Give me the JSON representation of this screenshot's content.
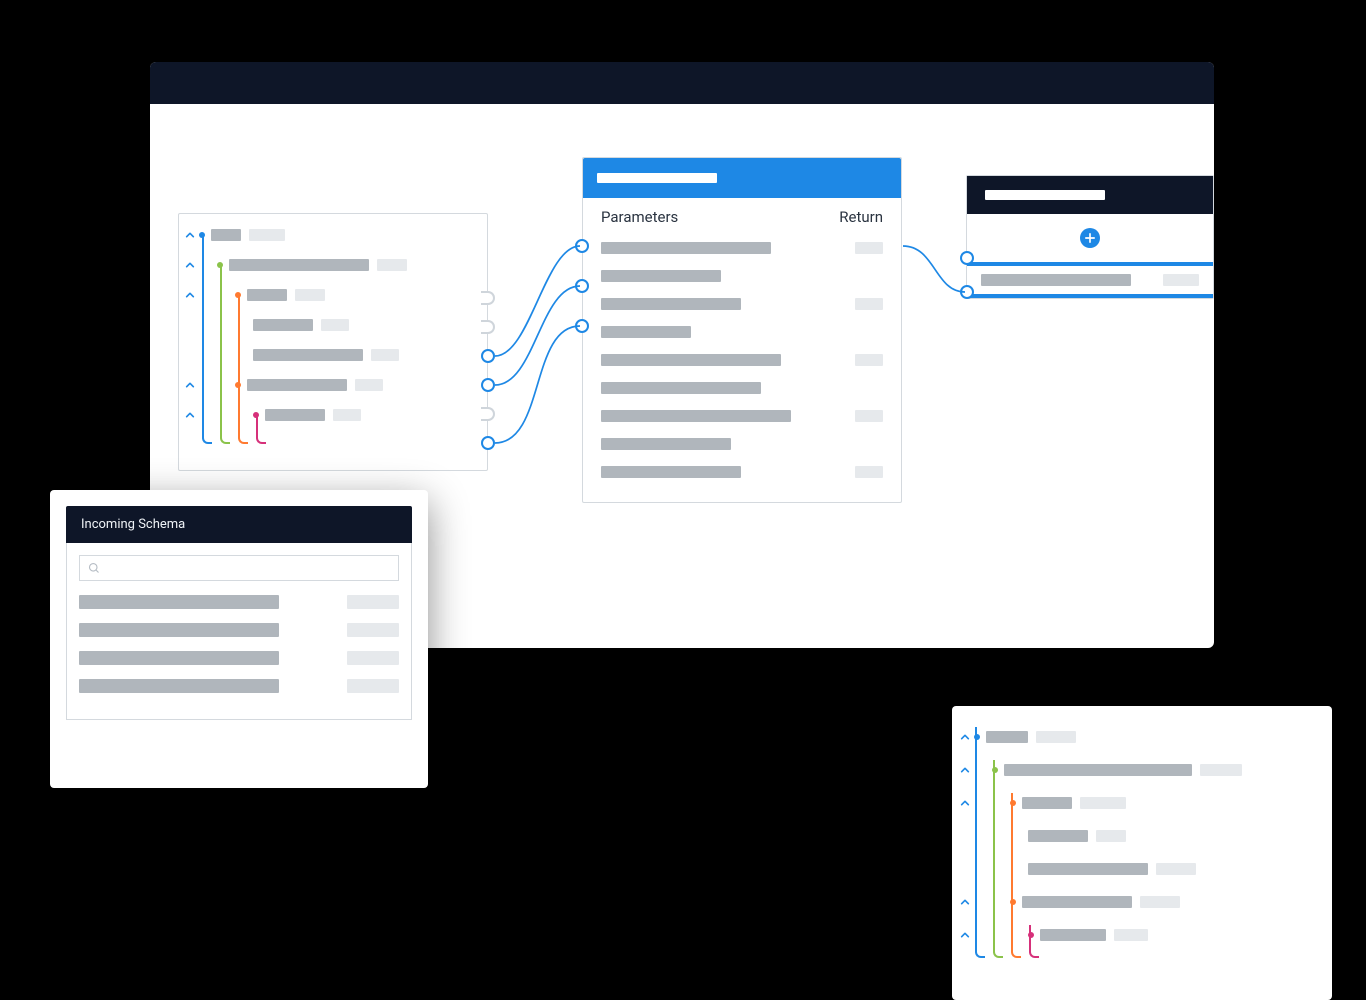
{
  "params_card": {
    "parameters_label": "Parameters",
    "return_label": "Return"
  },
  "incoming_schema": {
    "title": "Incoming Schema"
  },
  "colors": {
    "accent": "#1e88e5",
    "tree_blue": "#1e88e5",
    "tree_green": "#8bc34a",
    "tree_orange": "#ff7a30",
    "tree_magenta": "#d6307a"
  },
  "source_tree": [
    {
      "level": 0,
      "color": "tree_blue",
      "bar1": 30,
      "bar2": 36,
      "chevron": true
    },
    {
      "level": 1,
      "color": "tree_green",
      "bar1": 140,
      "bar2": 30,
      "chevron": true
    },
    {
      "level": 2,
      "color": "tree_orange",
      "bar1": 40,
      "bar2": 30,
      "chevron": true
    },
    {
      "level": 3,
      "color": null,
      "bar1": 60,
      "bar2": 28,
      "chevron": false
    },
    {
      "level": 3,
      "color": null,
      "bar1": 110,
      "bar2": 28,
      "chevron": false
    },
    {
      "level": 2,
      "color": "tree_orange",
      "bar1": 100,
      "bar2": 28,
      "chevron": true
    },
    {
      "level": 3,
      "color": "tree_magenta",
      "bar1": 60,
      "bar2": 28,
      "chevron": true
    },
    {
      "level": 4,
      "color": null,
      "bar1": 0,
      "bar2": 0,
      "chevron": false
    }
  ],
  "right_tree": [
    {
      "level": 0,
      "color": "tree_blue",
      "bar1": 42,
      "bar2": 40,
      "chevron": true
    },
    {
      "level": 1,
      "color": "tree_green",
      "bar1": 188,
      "bar2": 42,
      "chevron": true
    },
    {
      "level": 2,
      "color": "tree_orange",
      "bar1": 50,
      "bar2": 46,
      "chevron": true
    },
    {
      "level": 3,
      "color": null,
      "bar1": 60,
      "bar2": 30,
      "chevron": false
    },
    {
      "level": 3,
      "color": null,
      "bar1": 120,
      "bar2": 40,
      "chevron": false
    },
    {
      "level": 2,
      "color": "tree_orange",
      "bar1": 110,
      "bar2": 40,
      "chevron": true
    },
    {
      "level": 3,
      "color": "tree_magenta",
      "bar1": 66,
      "bar2": 34,
      "chevron": true
    },
    {
      "level": 4,
      "color": null,
      "bar1": 0,
      "bar2": 0,
      "chevron": false
    }
  ],
  "param_rows": [
    {
      "w1": 170,
      "w2": 28
    },
    {
      "w1": 120,
      "w2": 0
    },
    {
      "w1": 140,
      "w2": 28
    },
    {
      "w1": 90,
      "w2": 0
    },
    {
      "w1": 180,
      "w2": 28
    },
    {
      "w1": 160,
      "w2": 0
    },
    {
      "w1": 190,
      "w2": 28
    },
    {
      "w1": 130,
      "w2": 0
    },
    {
      "w1": 140,
      "w2": 28
    }
  ],
  "incoming_rows": [
    {
      "w1": 200,
      "w2": 52
    },
    {
      "w1": 200,
      "w2": 52
    },
    {
      "w1": 200,
      "w2": 52
    },
    {
      "w1": 200,
      "w2": 52
    }
  ]
}
